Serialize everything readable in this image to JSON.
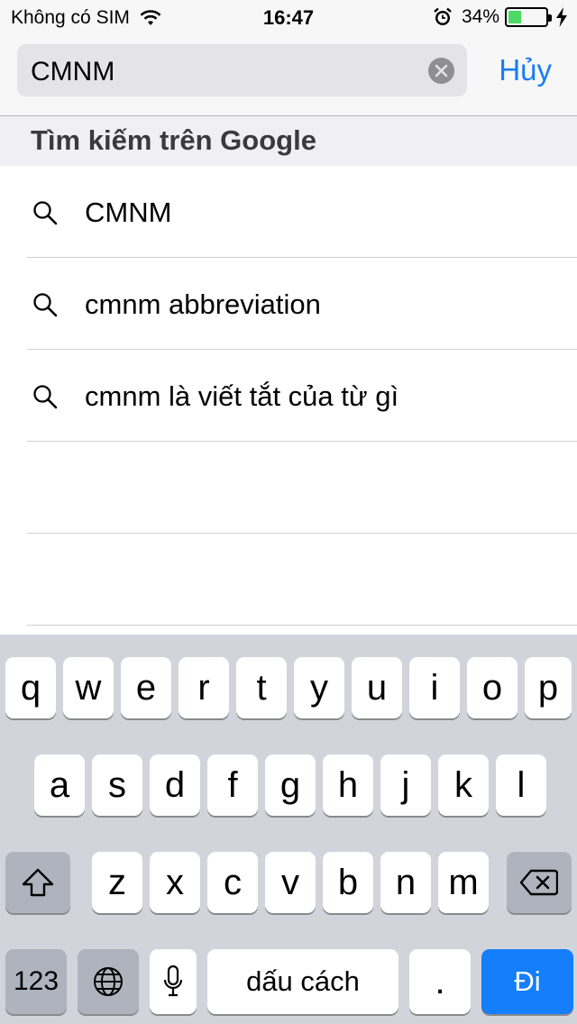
{
  "status_bar": {
    "carrier": "Không có SIM",
    "time": "16:47",
    "battery_percent": "34%",
    "battery_level": 0.34,
    "icons": [
      "wifi-icon",
      "alarm-icon",
      "battery-icon",
      "charging-bolt-icon"
    ]
  },
  "search": {
    "value": "CMNM",
    "cancel_label": "Hủy"
  },
  "section": {
    "title": "Tìm kiếm trên Google"
  },
  "suggestions": [
    {
      "label": "CMNM"
    },
    {
      "label": "cmnm abbreviation"
    },
    {
      "label": "cmnm là viết tắt của từ gì"
    }
  ],
  "keyboard": {
    "row1": [
      "q",
      "w",
      "e",
      "r",
      "t",
      "y",
      "u",
      "i",
      "o",
      "p"
    ],
    "row2": [
      "a",
      "s",
      "d",
      "f",
      "g",
      "h",
      "j",
      "k",
      "l"
    ],
    "row3": [
      "z",
      "x",
      "c",
      "v",
      "b",
      "n",
      "m"
    ],
    "numbers_label": "123",
    "space_label": "dấu cách",
    "period_label": ".",
    "go_label": "Đi"
  },
  "colors": {
    "accent": "#1a7cf5",
    "go_key": "#157efb",
    "battery": "#4cd964"
  }
}
